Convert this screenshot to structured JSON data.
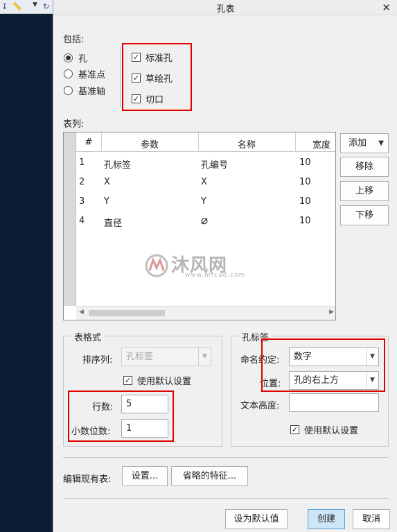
{
  "dialog": {
    "title": "孔表",
    "close_glyph": "✕"
  },
  "include": {
    "label": "包括:",
    "radios": [
      {
        "label": "孔",
        "selected": true
      },
      {
        "label": "基准点",
        "selected": false
      },
      {
        "label": "基准轴",
        "selected": false
      }
    ],
    "checks": [
      {
        "label": "标准孔",
        "checked": true
      },
      {
        "label": "草绘孔",
        "checked": true
      },
      {
        "label": "切口",
        "checked": true
      }
    ]
  },
  "columns": {
    "label": "表列:",
    "headers": [
      "#",
      "参数",
      "名称",
      "宽度"
    ],
    "rows": [
      [
        "1",
        "孔标签",
        "孔编号",
        "10"
      ],
      [
        "2",
        "X",
        "X",
        "10"
      ],
      [
        "3",
        "Y",
        "Y",
        "10"
      ],
      [
        "4",
        "直径",
        "⌀",
        "10"
      ]
    ],
    "buttons": {
      "add": "添加",
      "remove": "移除",
      "up": "上移",
      "down": "下移"
    }
  },
  "watermark": {
    "brand": "沐风网",
    "url": "www.mfcad.com"
  },
  "table_format": {
    "title": "表格式",
    "sort_label": "排序列:",
    "sort_value": "孔标签",
    "use_default": "使用默认设置",
    "use_default_checked": true,
    "rows_label": "行数:",
    "rows_value": "5",
    "decimals_label": "小数位数:",
    "decimals_value": "1"
  },
  "hole_label": {
    "title": "孔标签",
    "naming_label": "命名约定:",
    "naming_value": "数字",
    "position_label": "位置:",
    "position_value": "孔的右上方",
    "text_height_label": "文本高度:",
    "text_height_value": "",
    "use_default": "使用默认设置",
    "use_default_checked": true
  },
  "edit_existing": {
    "label": "编辑现有表:",
    "settings_button": "设置...",
    "omitted_button": "省略的特征..."
  },
  "footer": {
    "set_default": "设为默认值",
    "create": "创建",
    "cancel": "取消"
  },
  "colors": {
    "highlight_box": "#e00000",
    "primary_button": "#cde6f7",
    "side_panel": "#0c1c33"
  }
}
